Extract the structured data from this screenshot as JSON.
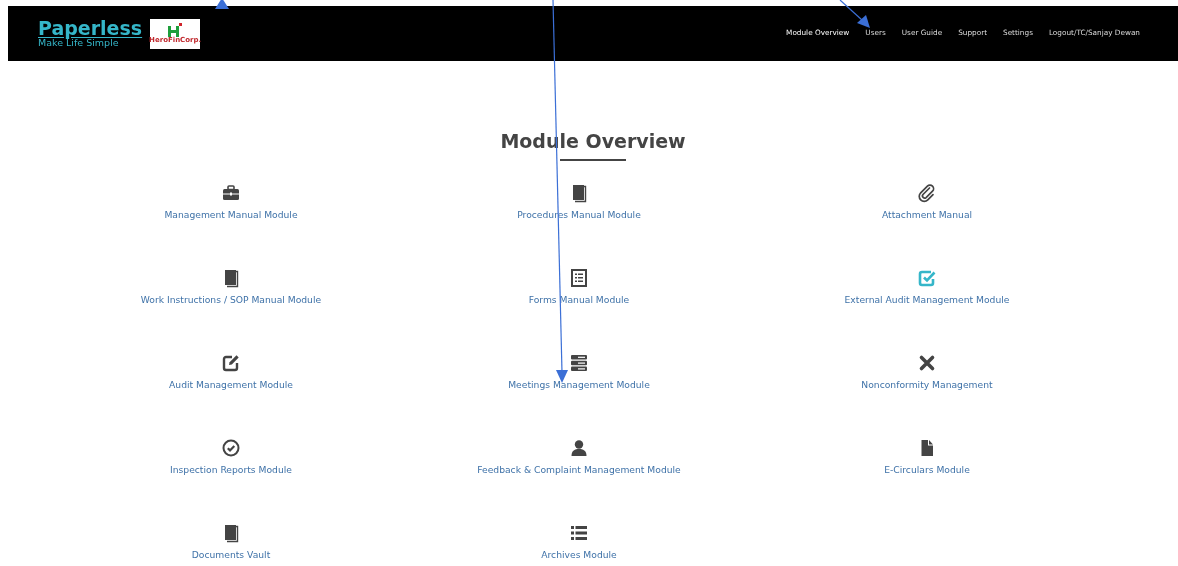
{
  "header": {
    "logo_title": "Paperless",
    "logo_tagline": "Make Life Simple",
    "partner_logo_text": "HeroFinCorp.",
    "nav": [
      {
        "label": "Module Overview",
        "selected": true
      },
      {
        "label": "Users",
        "selected": false
      },
      {
        "label": "User Guide",
        "selected": false
      },
      {
        "label": "Support",
        "selected": false
      },
      {
        "label": "Settings",
        "selected": false
      },
      {
        "label": "Logout/TC/Sanjay Dewan",
        "selected": false
      }
    ]
  },
  "page_title": "Module Overview",
  "modules": [
    {
      "label": "Management Manual Module",
      "kind": "briefcase",
      "color": "#444444"
    },
    {
      "label": "Procedures Manual Module",
      "kind": "book",
      "color": "#444444"
    },
    {
      "label": "Attachment Manual",
      "kind": "paperclip",
      "color": "#444444"
    },
    {
      "label": "Work Instructions / SOP Manual Module",
      "kind": "book",
      "color": "#444444"
    },
    {
      "label": "Forms Manual Module",
      "kind": "form",
      "color": "#444444"
    },
    {
      "label": "External Audit Management Module",
      "kind": "checkbox",
      "color": "#35b6c9"
    },
    {
      "label": "Audit Management Module",
      "kind": "edit",
      "color": "#444444"
    },
    {
      "label": "Meetings Management Module",
      "kind": "server",
      "color": "#444444"
    },
    {
      "label": "Nonconformity Management",
      "kind": "cross",
      "color": "#444444"
    },
    {
      "label": "Inspection Reports Module",
      "kind": "check-circle",
      "color": "#444444"
    },
    {
      "label": "Feedback & Complaint Management Module",
      "kind": "user",
      "color": "#444444"
    },
    {
      "label": "E-Circulars Module",
      "kind": "file",
      "color": "#444444"
    },
    {
      "label": "Documents Vault",
      "kind": "book",
      "color": "#444444"
    },
    {
      "label": "Archives Module",
      "kind": "list",
      "color": "#444444"
    }
  ]
}
